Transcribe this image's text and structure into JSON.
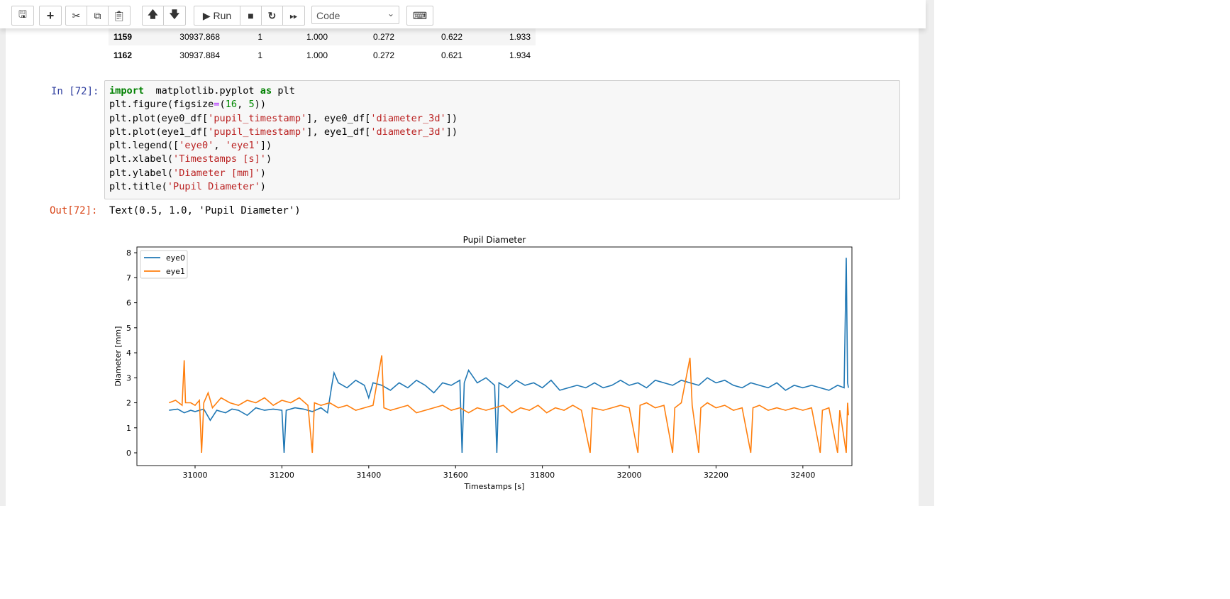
{
  "toolbar": {
    "buttons": [
      {
        "name": "save",
        "icon": "save-icon"
      },
      {
        "name": "insert-cell",
        "icon": "plus-icon"
      },
      {
        "name": "cut",
        "icon": "scissors-icon"
      },
      {
        "name": "copy",
        "icon": "copy-icon"
      },
      {
        "name": "paste",
        "icon": "paste-icon"
      },
      {
        "name": "move-up",
        "icon": "arrow-up-icon"
      },
      {
        "name": "move-down",
        "icon": "arrow-down-icon"
      }
    ],
    "run_label": "Run",
    "cell_type": "Code"
  },
  "table": {
    "rows": [
      [
        "1159",
        "30937.868",
        "1",
        "1.000",
        "0.272",
        "0.622",
        "1.933"
      ],
      [
        "1162",
        "30937.884",
        "1",
        "1.000",
        "0.272",
        "0.621",
        "1.934"
      ]
    ]
  },
  "cell": {
    "in_prompt": "In [72]:",
    "out_prompt": "Out[72]:",
    "output_text": "Text(0.5, 1.0, 'Pupil Diameter')",
    "code_lines": [
      [
        [
          "kw",
          "import"
        ],
        [
          "",
          "  matplotlib.pyplot "
        ],
        [
          "kw",
          "as"
        ],
        [
          "",
          " plt"
        ]
      ],
      [
        [
          "",
          "plt.figure(figsize"
        ],
        [
          "op",
          "="
        ],
        [
          "",
          "("
        ],
        [
          "num",
          "16"
        ],
        [
          "",
          ", "
        ],
        [
          "num",
          "5"
        ],
        [
          "",
          "))"
        ]
      ],
      [
        [
          "",
          "plt.plot(eye0_df["
        ],
        [
          "str",
          "'pupil_timestamp'"
        ],
        [
          "",
          "], eye0_df["
        ],
        [
          "str",
          "'diameter_3d'"
        ],
        [
          "",
          "])"
        ]
      ],
      [
        [
          "",
          "plt.plot(eye1_df["
        ],
        [
          "str",
          "'pupil_timestamp'"
        ],
        [
          "",
          "], eye1_df["
        ],
        [
          "str",
          "'diameter_3d'"
        ],
        [
          "",
          "])"
        ]
      ],
      [
        [
          "",
          "plt.legend(["
        ],
        [
          "str",
          "'eye0'"
        ],
        [
          "",
          ", "
        ],
        [
          "str",
          "'eye1'"
        ],
        [
          "",
          "])"
        ]
      ],
      [
        [
          "",
          "plt.xlabel("
        ],
        [
          "str",
          "'Timestamps [s]'"
        ],
        [
          "",
          ")"
        ]
      ],
      [
        [
          "",
          "plt.ylabel("
        ],
        [
          "str",
          "'Diameter [mm]'"
        ],
        [
          "",
          ")"
        ]
      ],
      [
        [
          "",
          "plt.title("
        ],
        [
          "str",
          "'Pupil Diameter'"
        ],
        [
          "",
          ")"
        ]
      ]
    ]
  },
  "chart_data": {
    "type": "line",
    "title": "Pupil Diameter",
    "xlabel": "Timestamps [s]",
    "ylabel": "Diameter [mm]",
    "xlim": [
      30866,
      32513
    ],
    "ylim": [
      -0.51,
      8.23
    ],
    "xticks": [
      31000,
      31200,
      31400,
      31600,
      31800,
      32000,
      32200,
      32400
    ],
    "yticks": [
      0,
      1,
      2,
      3,
      4,
      5,
      6,
      7,
      8
    ],
    "legend": "upper-left",
    "grid": false,
    "series": [
      {
        "name": "eye0",
        "color": "#1f77b4",
        "points": [
          [
            30940,
            1.7
          ],
          [
            30960,
            1.75
          ],
          [
            30975,
            1.6
          ],
          [
            30990,
            1.7
          ],
          [
            31000,
            1.65
          ],
          [
            31020,
            1.75
          ],
          [
            31035,
            1.3
          ],
          [
            31050,
            1.7
          ],
          [
            31070,
            1.6
          ],
          [
            31085,
            1.75
          ],
          [
            31100,
            1.7
          ],
          [
            31120,
            1.5
          ],
          [
            31140,
            1.8
          ],
          [
            31160,
            1.7
          ],
          [
            31180,
            1.75
          ],
          [
            31200,
            1.7
          ],
          [
            31205,
            0
          ],
          [
            31210,
            1.7
          ],
          [
            31230,
            1.8
          ],
          [
            31250,
            1.75
          ],
          [
            31270,
            1.65
          ],
          [
            31290,
            1.8
          ],
          [
            31305,
            1.6
          ],
          [
            31315,
            2.7
          ],
          [
            31320,
            3.2
          ],
          [
            31330,
            2.8
          ],
          [
            31350,
            2.6
          ],
          [
            31370,
            2.9
          ],
          [
            31390,
            2.7
          ],
          [
            31400,
            2.2
          ],
          [
            31410,
            2.8
          ],
          [
            31430,
            2.7
          ],
          [
            31450,
            2.5
          ],
          [
            31470,
            2.8
          ],
          [
            31490,
            2.6
          ],
          [
            31510,
            2.9
          ],
          [
            31530,
            2.7
          ],
          [
            31550,
            2.4
          ],
          [
            31570,
            2.8
          ],
          [
            31590,
            2.7
          ],
          [
            31610,
            2.9
          ],
          [
            31615,
            0
          ],
          [
            31620,
            2.8
          ],
          [
            31630,
            3.3
          ],
          [
            31650,
            2.8
          ],
          [
            31670,
            3.0
          ],
          [
            31690,
            2.7
          ],
          [
            31695,
            0
          ],
          [
            31700,
            2.8
          ],
          [
            31720,
            2.6
          ],
          [
            31740,
            2.9
          ],
          [
            31760,
            2.7
          ],
          [
            31780,
            2.8
          ],
          [
            31800,
            2.6
          ],
          [
            31820,
            2.9
          ],
          [
            31840,
            2.5
          ],
          [
            31860,
            2.6
          ],
          [
            31880,
            2.7
          ],
          [
            31900,
            2.6
          ],
          [
            31920,
            2.8
          ],
          [
            31940,
            2.6
          ],
          [
            31960,
            2.7
          ],
          [
            31980,
            2.9
          ],
          [
            32000,
            2.7
          ],
          [
            32020,
            2.8
          ],
          [
            32040,
            2.6
          ],
          [
            32060,
            2.9
          ],
          [
            32080,
            2.8
          ],
          [
            32100,
            2.7
          ],
          [
            32120,
            2.9
          ],
          [
            32140,
            2.8
          ],
          [
            32160,
            2.7
          ],
          [
            32180,
            3.0
          ],
          [
            32200,
            2.8
          ],
          [
            32220,
            2.9
          ],
          [
            32240,
            2.7
          ],
          [
            32260,
            2.6
          ],
          [
            32280,
            2.8
          ],
          [
            32300,
            2.7
          ],
          [
            32320,
            2.6
          ],
          [
            32340,
            2.8
          ],
          [
            32360,
            2.5
          ],
          [
            32380,
            2.7
          ],
          [
            32400,
            2.6
          ],
          [
            32420,
            2.7
          ],
          [
            32440,
            2.6
          ],
          [
            32460,
            2.5
          ],
          [
            32480,
            2.7
          ],
          [
            32495,
            2.6
          ],
          [
            32500,
            7.8
          ],
          [
            32503,
            2.8
          ],
          [
            32505,
            2.6
          ]
        ]
      },
      {
        "name": "eye1",
        "color": "#ff7f0e",
        "points": [
          [
            30940,
            2.0
          ],
          [
            30955,
            2.1
          ],
          [
            30970,
            1.9
          ],
          [
            30975,
            3.7
          ],
          [
            30978,
            2.0
          ],
          [
            30990,
            2.0
          ],
          [
            31000,
            1.9
          ],
          [
            31010,
            2.1
          ],
          [
            31015,
            0
          ],
          [
            31020,
            2.0
          ],
          [
            31030,
            2.4
          ],
          [
            31040,
            1.8
          ],
          [
            31060,
            2.2
          ],
          [
            31080,
            2.0
          ],
          [
            31100,
            1.9
          ],
          [
            31120,
            2.1
          ],
          [
            31140,
            2.0
          ],
          [
            31160,
            2.2
          ],
          [
            31180,
            1.9
          ],
          [
            31200,
            2.1
          ],
          [
            31220,
            2.0
          ],
          [
            31240,
            2.2
          ],
          [
            31260,
            1.9
          ],
          [
            31270,
            0
          ],
          [
            31275,
            2.0
          ],
          [
            31290,
            1.9
          ],
          [
            31310,
            2.0
          ],
          [
            31330,
            1.8
          ],
          [
            31350,
            1.9
          ],
          [
            31370,
            1.7
          ],
          [
            31390,
            1.8
          ],
          [
            31410,
            1.9
          ],
          [
            31430,
            3.9
          ],
          [
            31435,
            1.8
          ],
          [
            31450,
            1.7
          ],
          [
            31470,
            1.8
          ],
          [
            31490,
            1.9
          ],
          [
            31510,
            1.6
          ],
          [
            31530,
            1.7
          ],
          [
            31550,
            1.8
          ],
          [
            31570,
            1.9
          ],
          [
            31590,
            1.7
          ],
          [
            31610,
            1.8
          ],
          [
            31630,
            1.6
          ],
          [
            31650,
            1.8
          ],
          [
            31670,
            1.7
          ],
          [
            31690,
            1.8
          ],
          [
            31710,
            1.9
          ],
          [
            31730,
            1.6
          ],
          [
            31750,
            1.8
          ],
          [
            31770,
            1.7
          ],
          [
            31790,
            1.9
          ],
          [
            31810,
            1.6
          ],
          [
            31830,
            1.8
          ],
          [
            31850,
            1.7
          ],
          [
            31870,
            1.9
          ],
          [
            31890,
            1.7
          ],
          [
            31910,
            0
          ],
          [
            31915,
            1.8
          ],
          [
            31940,
            1.7
          ],
          [
            31960,
            1.8
          ],
          [
            31980,
            1.9
          ],
          [
            32000,
            1.8
          ],
          [
            32020,
            0
          ],
          [
            32025,
            1.9
          ],
          [
            32040,
            2.0
          ],
          [
            32060,
            1.8
          ],
          [
            32080,
            1.9
          ],
          [
            32100,
            0
          ],
          [
            32105,
            1.8
          ],
          [
            32120,
            2.0
          ],
          [
            32140,
            3.8
          ],
          [
            32145,
            1.9
          ],
          [
            32160,
            0
          ],
          [
            32165,
            1.8
          ],
          [
            32180,
            2.0
          ],
          [
            32200,
            1.8
          ],
          [
            32220,
            1.9
          ],
          [
            32240,
            1.7
          ],
          [
            32260,
            1.8
          ],
          [
            32280,
            0
          ],
          [
            32285,
            1.8
          ],
          [
            32300,
            1.9
          ],
          [
            32320,
            1.7
          ],
          [
            32340,
            1.8
          ],
          [
            32360,
            1.7
          ],
          [
            32380,
            1.8
          ],
          [
            32400,
            1.7
          ],
          [
            32420,
            1.8
          ],
          [
            32440,
            0
          ],
          [
            32445,
            1.7
          ],
          [
            32460,
            1.8
          ],
          [
            32480,
            0
          ],
          [
            32485,
            1.7
          ],
          [
            32500,
            0
          ],
          [
            32503,
            2.0
          ],
          [
            32505,
            1.5
          ]
        ]
      }
    ]
  }
}
